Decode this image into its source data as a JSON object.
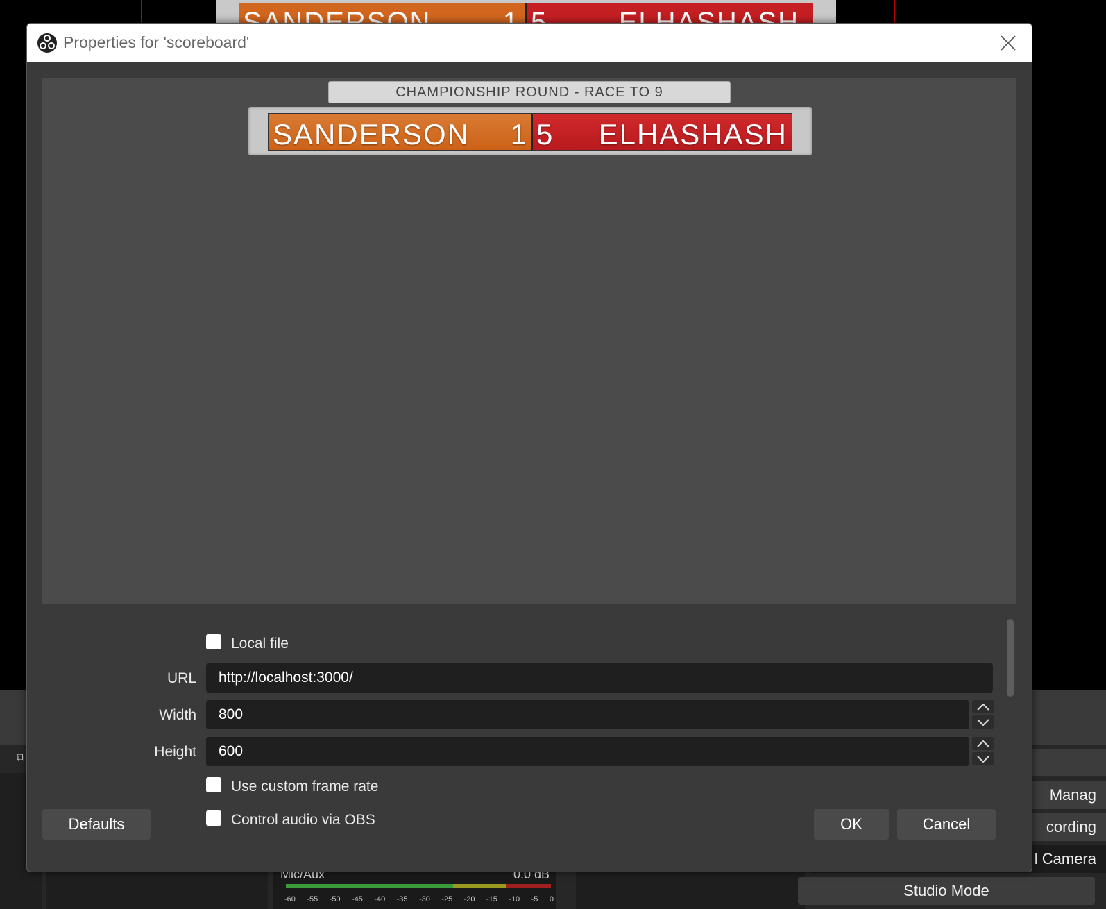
{
  "background": {
    "scoreboard": {
      "left_name": "SANDERSON",
      "left_score": "1",
      "right_score": "5",
      "right_name": "ELHASHASH"
    },
    "controls": {
      "title_partial": "ls",
      "manage_partial": "Manag",
      "recording_partial": "cording",
      "camera_partial": "l Camera",
      "studio_mode": "Studio Mode"
    },
    "mixer": {
      "label": "Mic/Aux",
      "db": "0.0 dB",
      "ticks": [
        "-60",
        "-55",
        "-50",
        "-45",
        "-40",
        "-35",
        "-30",
        "-25",
        "-20",
        "-15",
        "-10",
        "-5",
        "0"
      ]
    }
  },
  "dialog": {
    "title": "Properties for 'scoreboard'",
    "preview": {
      "header": "CHAMPIONSHIP ROUND - RACE TO 9",
      "left_name": "SANDERSON",
      "left_score": "1",
      "right_score": "5",
      "right_name": "ELHASHASH"
    },
    "properties": {
      "local_file_label": "Local file",
      "url_label": "URL",
      "url_value": "http://localhost:3000/",
      "width_label": "Width",
      "width_value": "800",
      "height_label": "Height",
      "height_value": "600",
      "custom_fps_label": "Use custom frame rate",
      "control_audio_label": "Control audio via OBS"
    },
    "buttons": {
      "defaults": "Defaults",
      "ok": "OK",
      "cancel": "Cancel"
    }
  }
}
